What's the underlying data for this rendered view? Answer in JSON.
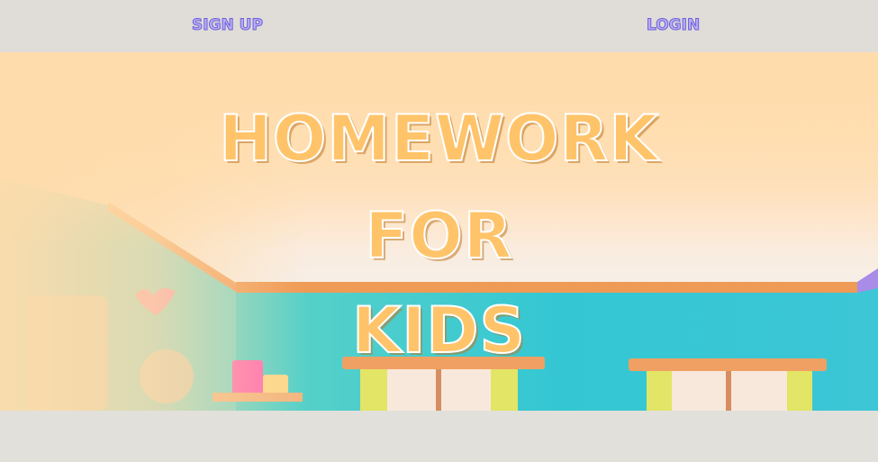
{
  "nav": {
    "signup_label": "SIGN UP",
    "login_label": "LOGIN"
  },
  "hero": {
    "title_line_1": "HOMEWORK",
    "title_line_2": "FOR",
    "title_line_3": "KIDS"
  },
  "colors": {
    "topbar": "#e0ddd8",
    "nav_text": "#b8aef5",
    "title_text": "#ffc46a",
    "room_wall": "#3ec9d2",
    "room_ceiling": "#fde5c6"
  }
}
